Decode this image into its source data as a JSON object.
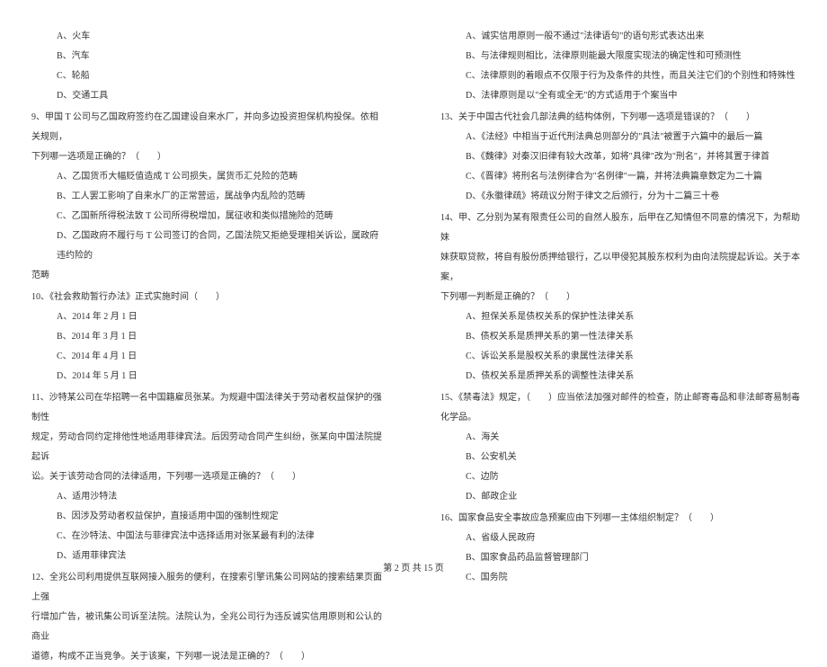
{
  "left": {
    "q8_options": {
      "a": "A、火车",
      "b": "B、汽车",
      "c": "C、轮船",
      "d": "D、交通工具"
    },
    "q9": {
      "stem_line1": "9、甲国 T 公司与乙国政府签约在乙国建设自来水厂，并向多边投资担保机构投保。依相关规则，",
      "stem_line2": "下列哪一选项是正确的？（　　）",
      "a": "A、乙国货币大幅贬值造成 T 公司损失，属货币汇兑险的范畴",
      "b": "B、工人罢工影响了自来水厂的正常营运，属战争内乱险的范畴",
      "c": "C、乙国新所得税法致 T 公司所得税增加，属征收和类似措施险的范畴",
      "d_line1": "D、乙国政府不履行与 T 公司签订的合同，乙国法院又拒绝受理相关诉讼，属政府违约险的",
      "d_line2": "范畴"
    },
    "q10": {
      "stem": "10、《社会救助暂行办法》正式实施时间（　　）",
      "a": "A、2014 年 2 月 1 日",
      "b": "B、2014 年 3 月 1 日",
      "c": "C、2014 年 4 月 1 日",
      "d": "D、2014 年 5 月 1 日"
    },
    "q11": {
      "stem_line1": "11、沙特某公司在华招聘一名中国籍雇员张某。为规避中国法律关于劳动者权益保护的强制性",
      "stem_line2": "规定，劳动合同约定排他性地适用菲律宾法。后因劳动合同产生纠纷，张某向中国法院提起诉",
      "stem_line3": "讼。关于该劳动合同的法律适用，下列哪一选项是正确的？（　　）",
      "a": "A、适用沙特法",
      "b": "B、因涉及劳动者权益保护，直接适用中国的强制性规定",
      "c": "C、在沙特法、中国法与菲律宾法中选择适用对张某最有利的法律",
      "d": "D、适用菲律宾法"
    },
    "q12": {
      "stem_line1": "12、全兆公司利用提供互联网接入服务的便利，在搜索引擎讯集公司网站的搜索结果页面上强",
      "stem_line2": "行增加广告，被讯集公司诉至法院。法院认为，全兆公司行为违反诚实信用原则和公认的商业",
      "stem_line3": "道德，构成不正当竞争。关于该案，下列哪一说法是正确的？（　　）"
    }
  },
  "right": {
    "q12_options": {
      "a": "A、诚实信用原则一般不通过\"法律语句\"的语句形式表达出来",
      "b": "B、与法律规则相比，法律原则能最大限度实现法的确定性和可预测性",
      "c": "C、法律原则的着眼点不仅限于行为及条件的共性，而且关注它们的个别性和特殊性",
      "d": "D、法律原则是以\"全有或全无\"的方式适用于个案当中"
    },
    "q13": {
      "stem": "13、关于中国古代社会几部法典的结构体例，下列哪一选项是错误的？（　　）",
      "a": "A、《法经》中相当于近代刑法典总则部分的\"具法\"被置于六篇中的最后一篇",
      "b": "B、《魏律》对秦汉旧律有较大改革，如将\"具律\"改为\"刑名\"，并将其置于律首",
      "c": "C、《晋律》将刑名与法例律合为\"名例律\"一篇，并将法典篇章数定为二十篇",
      "d": "D、《永徽律疏》将疏议分附于律文之后颁行，分为十二篇三十卷"
    },
    "q14": {
      "stem_line1": "14、甲、乙分别为某有限责任公司的自然人股东，后甲在乙知情但不同意的情况下，为帮助妹",
      "stem_line2": "妹获取贷款，将自有股份质押给银行，乙以甲侵犯其股东权利为由向法院提起诉讼。关于本案，",
      "stem_line3": "下列哪一判断是正确的？（　　）",
      "a": "A、担保关系是债权关系的保护性法律关系",
      "b": "B、债权关系是质押关系的第一性法律关系",
      "c": "C、诉讼关系是股权关系的隶属性法律关系",
      "d": "D、债权关系是质押关系的调整性法律关系"
    },
    "q15": {
      "stem_line1": "15、《禁毒法》规定，（　　）应当依法加强对邮件的检查，防止邮寄毒品和非法邮寄易制毒",
      "stem_line2": "化学品。",
      "a": "A、海关",
      "b": "B、公安机关",
      "c": "C、边防",
      "d": "D、邮政企业"
    },
    "q16": {
      "stem": "16、国家食品安全事故应急预案应由下列哪一主体组织制定？（　　）",
      "a": "A、省级人民政府",
      "b": "B、国家食品药品监督管理部门",
      "c": "C、国务院"
    }
  },
  "footer": "第 2 页 共 15 页"
}
